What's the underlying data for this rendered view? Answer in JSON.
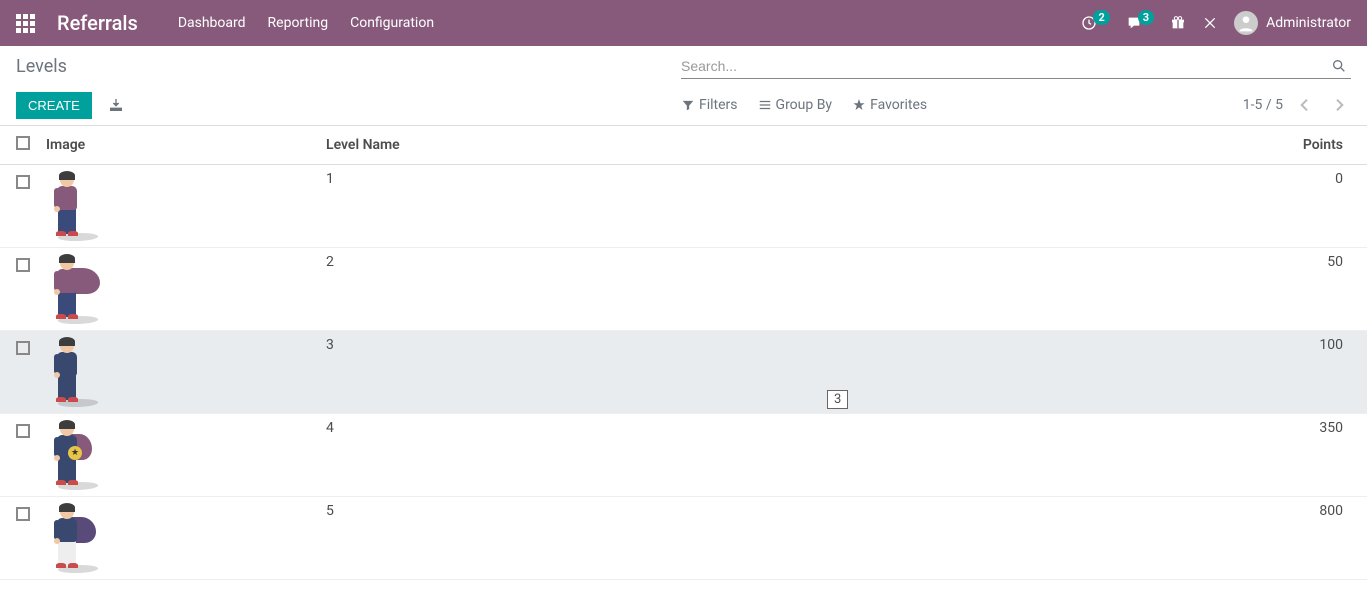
{
  "navbar": {
    "brand": "Referrals",
    "links": [
      "Dashboard",
      "Reporting",
      "Configuration"
    ],
    "activities_badge": "2",
    "messages_badge": "3",
    "user_name": "Administrator"
  },
  "breadcrumb": "Levels",
  "search": {
    "placeholder": "Search..."
  },
  "buttons": {
    "create": "Create"
  },
  "search_options": {
    "filters": "Filters",
    "group_by": "Group By",
    "favorites": "Favorites"
  },
  "pager": {
    "range": "1-5 / 5"
  },
  "columns": {
    "image": "Image",
    "level_name": "Level Name",
    "points": "Points"
  },
  "rows": [
    {
      "name": "1",
      "points": "0"
    },
    {
      "name": "2",
      "points": "50"
    },
    {
      "name": "3",
      "points": "100"
    },
    {
      "name": "4",
      "points": "350"
    },
    {
      "name": "5",
      "points": "800"
    }
  ],
  "tooltip": "3",
  "colors": {
    "primary": "#875A7B",
    "teal": "#00A09D"
  }
}
